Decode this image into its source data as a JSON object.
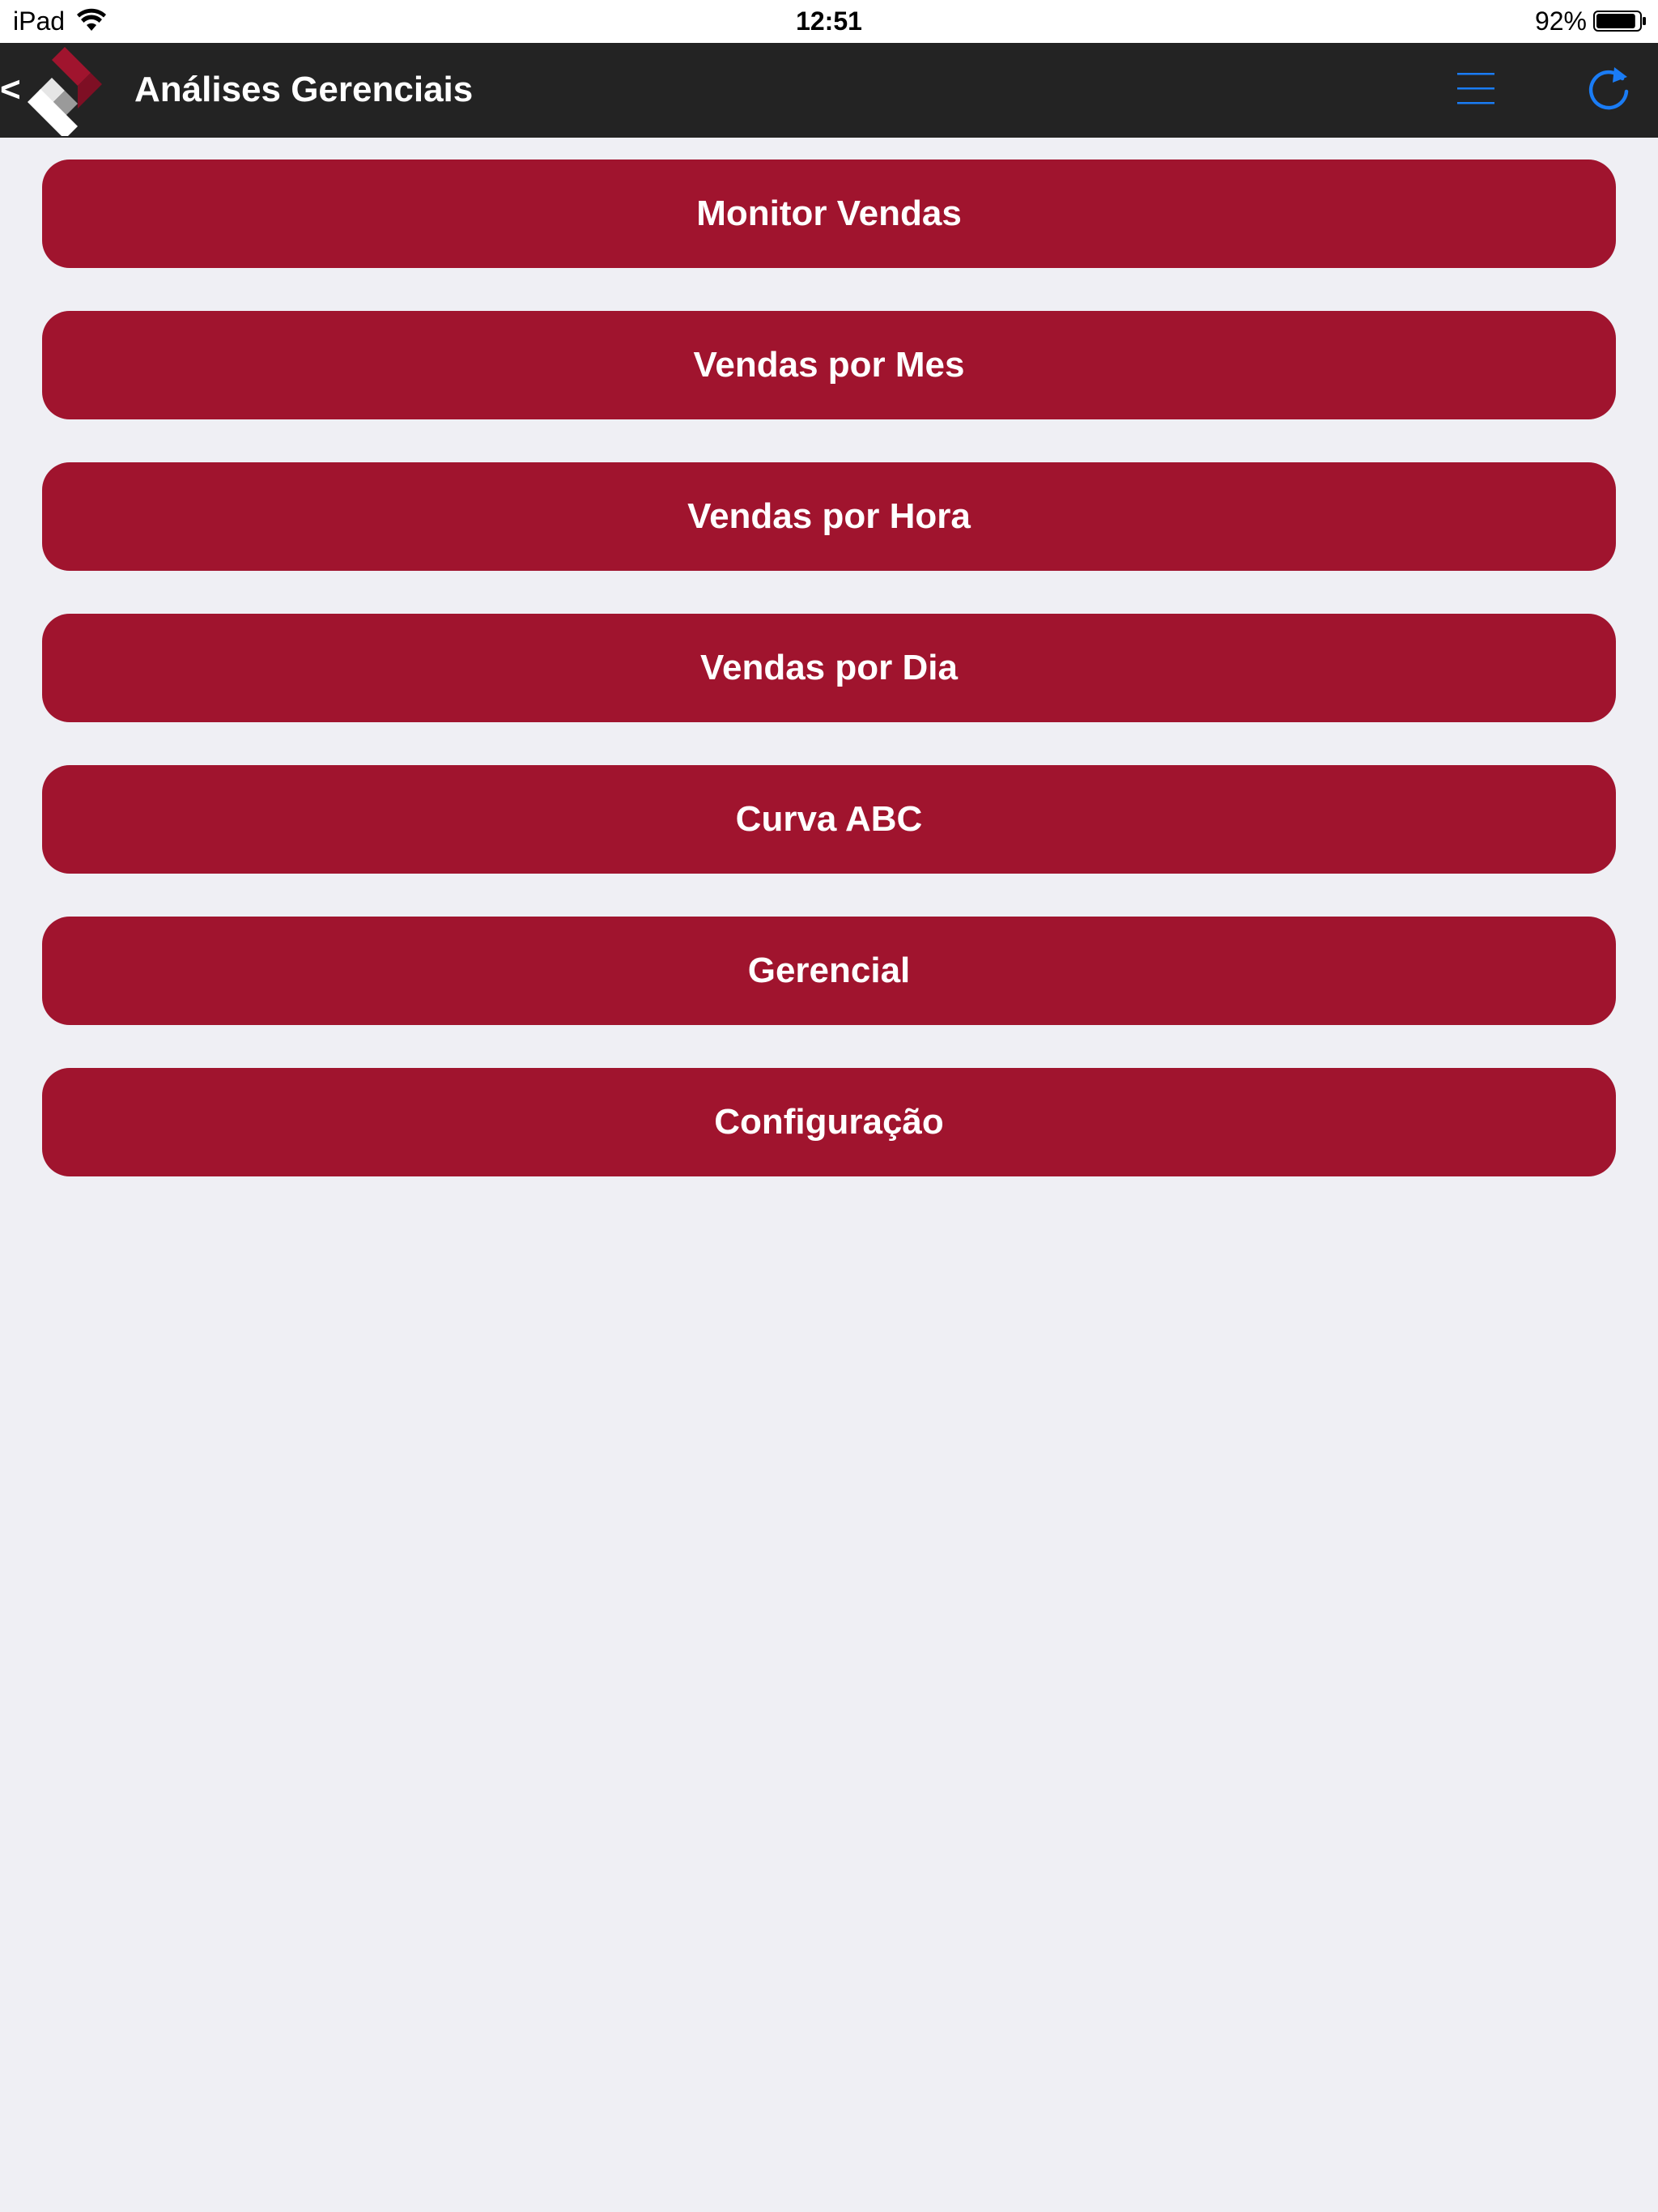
{
  "status_bar": {
    "carrier": "iPad",
    "time": "12:51",
    "battery_percent": "92%",
    "battery_level": 0.92
  },
  "nav_bar": {
    "back_label": "<",
    "title": "Análises Gerenciais",
    "icons": {
      "logo": "diamond-logo-icon",
      "menu": "hamburger-menu-icon",
      "refresh": "refresh-icon"
    },
    "accent_color": "#1a7cf5"
  },
  "menu": {
    "button_color": "#a0142e",
    "items": [
      {
        "label": "Monitor Vendas"
      },
      {
        "label": "Vendas por Mes"
      },
      {
        "label": "Vendas por Hora"
      },
      {
        "label": "Vendas por Dia"
      },
      {
        "label": "Curva ABC"
      },
      {
        "label": "Gerencial"
      },
      {
        "label": "Configuração"
      }
    ]
  }
}
